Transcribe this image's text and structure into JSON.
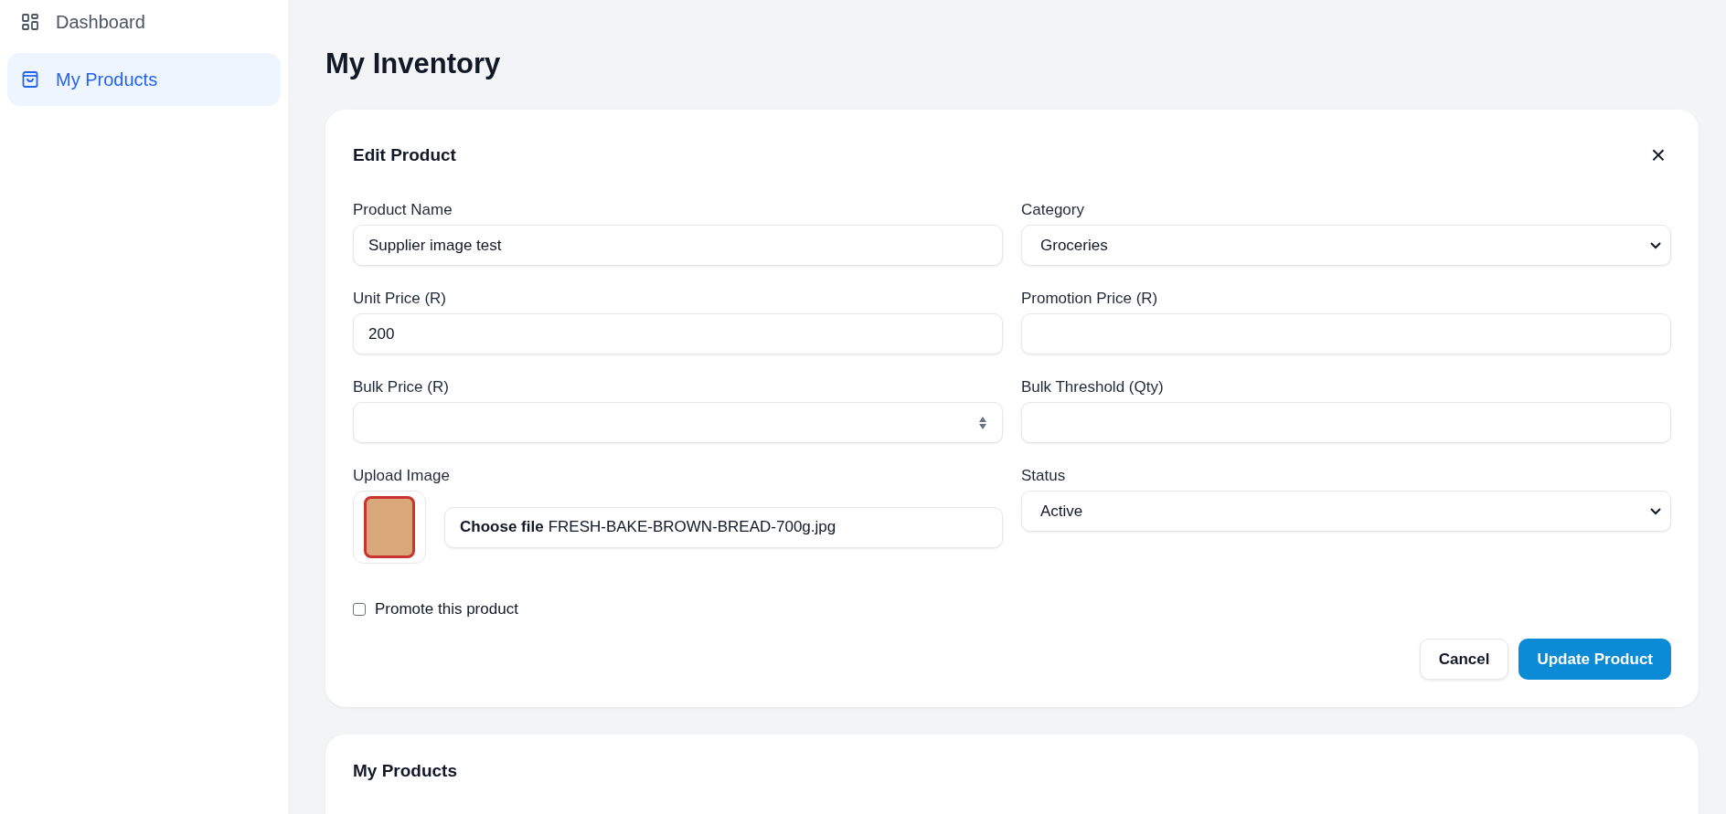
{
  "sidebar": {
    "items": [
      {
        "label": "Dashboard",
        "selected": false
      },
      {
        "label": "My Products",
        "selected": true
      }
    ]
  },
  "page_title": "My Inventory",
  "edit_card": {
    "title": "Edit Product",
    "close": "×",
    "fields": [
      {
        "kind": "text",
        "label": "Product Name",
        "value": "Supplier image test"
      },
      {
        "kind": "select",
        "label": "Category",
        "value": "Groceries"
      },
      {
        "kind": "text",
        "label": "Unit Price (R)",
        "value": "200"
      },
      {
        "kind": "text",
        "label": "Promotion Price (R)"
      },
      {
        "kind": "number",
        "label": "Bulk Price (R)"
      },
      {
        "kind": "text",
        "label": "Bulk Threshold (Qty)"
      },
      {
        "kind": "file",
        "label": "Upload Image",
        "button_label": "Choose file",
        "file_name": "FRESH-BAKE-BROWN-BREAD-700g.jpg"
      },
      {
        "kind": "select",
        "label": "Status",
        "value": "Active"
      }
    ],
    "promote": {
      "label": "Promote this product",
      "checked": false
    },
    "buttons": [
      {
        "label": "Cancel",
        "kind": "secondary"
      },
      {
        "label": "Update Product",
        "kind": "primary"
      }
    ]
  },
  "products_card": {
    "title": "My Products"
  }
}
